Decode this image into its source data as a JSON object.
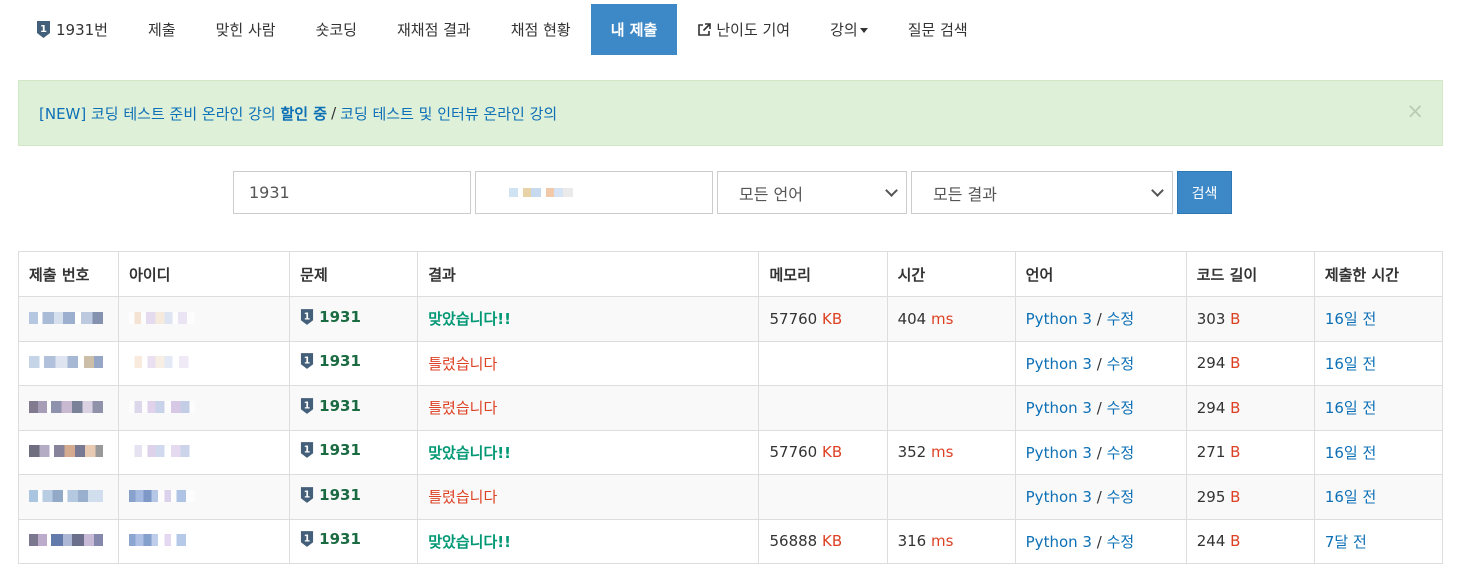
{
  "nav": {
    "items": [
      {
        "label": "1931번",
        "icon": "tier-badge-icon",
        "active": false
      },
      {
        "label": "제출",
        "active": false
      },
      {
        "label": "맞힌 사람",
        "active": false
      },
      {
        "label": "숏코딩",
        "active": false
      },
      {
        "label": "재채점 결과",
        "active": false
      },
      {
        "label": "채점 현황",
        "active": false
      },
      {
        "label": "내 제출",
        "active": true
      },
      {
        "label": "난이도 기여",
        "icon": "external-link-icon",
        "active": false
      },
      {
        "label": "강의",
        "dropdown": true,
        "active": false
      },
      {
        "label": "질문 검색",
        "active": false
      }
    ]
  },
  "alert": {
    "part1": "[NEW] 코딩 테스트 준비 온라인 강의 ",
    "highlight": "할인 중",
    "separator": "/",
    "part2": "코딩 테스트 및 인터뷰 온라인 강의",
    "close": "×"
  },
  "search": {
    "problem_value": "1931",
    "language_value": "모든 언어",
    "result_value": "모든 결과",
    "button_label": "검색"
  },
  "table": {
    "headers": [
      "제출 번호",
      "아이디",
      "문제",
      "결과",
      "메모리",
      "시간",
      "언어",
      "코드 길이",
      "제출한 시간"
    ],
    "rows": [
      {
        "problem": "1931",
        "result": "맞았습니다!!",
        "status": "ac",
        "memory": "57760",
        "memory_unit": "KB",
        "time": "404",
        "time_unit": "ms",
        "language": "Python 3",
        "slash": "/",
        "edit": "수정",
        "length": "303",
        "length_unit": "B",
        "submitted": "16일 전"
      },
      {
        "problem": "1931",
        "result": "틀렸습니다",
        "status": "wa",
        "memory": "",
        "memory_unit": "",
        "time": "",
        "time_unit": "",
        "language": "Python 3",
        "slash": "/",
        "edit": "수정",
        "length": "294",
        "length_unit": "B",
        "submitted": "16일 전"
      },
      {
        "problem": "1931",
        "result": "틀렸습니다",
        "status": "wa",
        "memory": "",
        "memory_unit": "",
        "time": "",
        "time_unit": "",
        "language": "Python 3",
        "slash": "/",
        "edit": "수정",
        "length": "294",
        "length_unit": "B",
        "submitted": "16일 전"
      },
      {
        "problem": "1931",
        "result": "맞았습니다!!",
        "status": "ac",
        "memory": "57760",
        "memory_unit": "KB",
        "time": "352",
        "time_unit": "ms",
        "language": "Python 3",
        "slash": "/",
        "edit": "수정",
        "length": "271",
        "length_unit": "B",
        "submitted": "16일 전"
      },
      {
        "problem": "1931",
        "result": "틀렸습니다",
        "status": "wa",
        "memory": "",
        "memory_unit": "",
        "time": "",
        "time_unit": "",
        "language": "Python 3",
        "slash": "/",
        "edit": "수정",
        "length": "295",
        "length_unit": "B",
        "submitted": "16일 전"
      },
      {
        "problem": "1931",
        "result": "맞았습니다!!",
        "status": "ac",
        "memory": "56888",
        "memory_unit": "KB",
        "time": "316",
        "time_unit": "ms",
        "language": "Python 3",
        "slash": "/",
        "edit": "수정",
        "length": "244",
        "length_unit": "B",
        "submitted": "7달 전"
      }
    ]
  },
  "colors": {
    "primary": "#3d88c6",
    "accepted": "#009874",
    "wrong": "#dd4124",
    "link": "#0d70b6",
    "alert_bg": "#dff0d8"
  }
}
